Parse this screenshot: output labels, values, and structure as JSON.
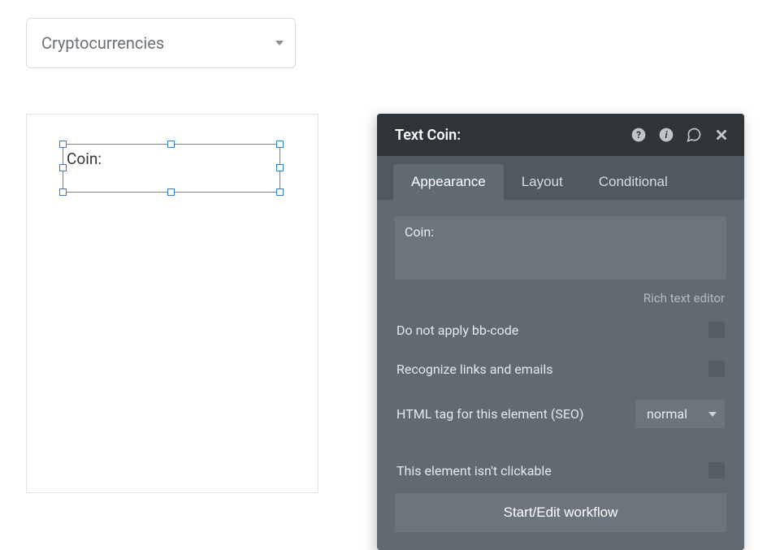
{
  "dropdown": {
    "selected": "Cryptocurrencies"
  },
  "canvas": {
    "selected_text": "Coin:"
  },
  "panel": {
    "title": "Text Coin:",
    "tabs": {
      "appearance": "Appearance",
      "layout": "Layout",
      "conditional": "Conditional"
    },
    "text_value": "Coin:",
    "rich_text_link": "Rich text editor",
    "rows": {
      "bbcode": "Do not apply bb-code",
      "links": "Recognize links and emails",
      "htmltag": "HTML tag for this element (SEO)",
      "clickable": "This element isn't clickable"
    },
    "htmltag_value": "normal",
    "workflow_button": "Start/Edit workflow"
  }
}
